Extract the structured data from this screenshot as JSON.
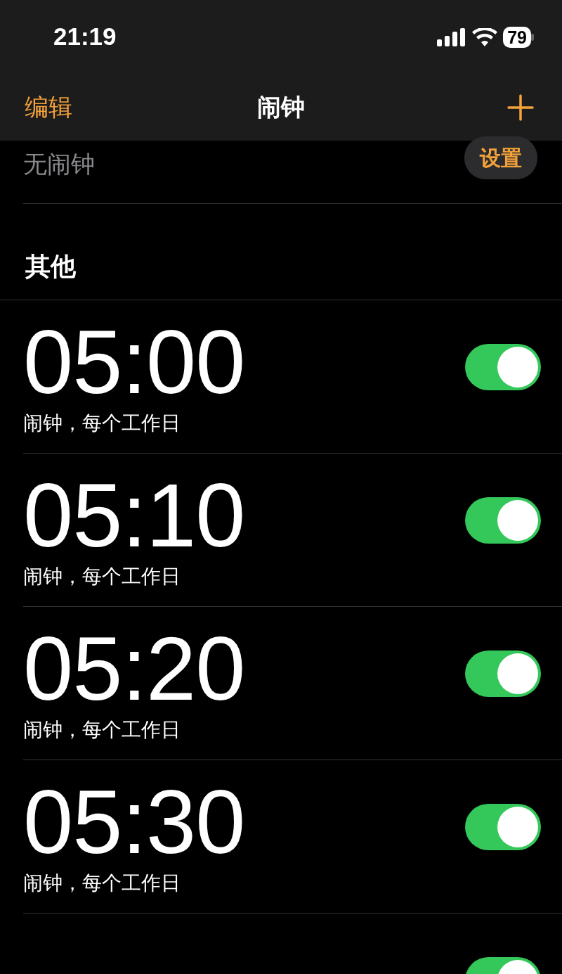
{
  "status_bar": {
    "time": "21:19",
    "battery": "79"
  },
  "nav": {
    "edit": "编辑",
    "title": "闹钟"
  },
  "sleep": {
    "label": "无闹钟",
    "button": "设置"
  },
  "section": "其他",
  "alarms": [
    {
      "time": "05:00",
      "label": "闹钟，每个工作日",
      "on": true
    },
    {
      "time": "05:10",
      "label": "闹钟，每个工作日",
      "on": true
    },
    {
      "time": "05:20",
      "label": "闹钟，每个工作日",
      "on": true
    },
    {
      "time": "05:30",
      "label": "闹钟，每个工作日",
      "on": true
    },
    {
      "on": true
    }
  ]
}
